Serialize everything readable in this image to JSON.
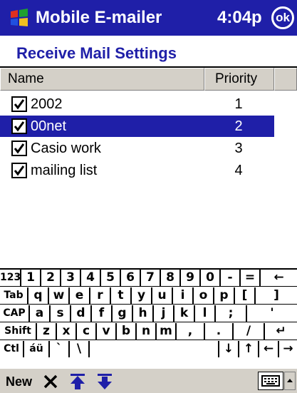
{
  "titlebar": {
    "app_title": "Mobile E-mailer",
    "clock": "4:04p",
    "ok_label": "ok",
    "bg_color": "#1f1fa8"
  },
  "page_title": "Receive Mail Settings",
  "list": {
    "columns": [
      "Name",
      "Priority"
    ],
    "rows": [
      {
        "name": "2002",
        "priority": "1",
        "checked": true,
        "selected": false
      },
      {
        "name": "00net",
        "priority": "2",
        "checked": true,
        "selected": true
      },
      {
        "name": "Casio work",
        "priority": "3",
        "checked": true,
        "selected": false
      },
      {
        "name": "mailing list",
        "priority": "4",
        "checked": true,
        "selected": false
      }
    ]
  },
  "keyboard": {
    "rows": [
      [
        "123",
        "1",
        "2",
        "3",
        "4",
        "5",
        "6",
        "7",
        "8",
        "9",
        "0",
        "-",
        "=",
        "←"
      ],
      [
        "Tab",
        "q",
        "w",
        "e",
        "r",
        "t",
        "y",
        "u",
        "i",
        "o",
        "p",
        "[",
        "]"
      ],
      [
        "CAP",
        "a",
        "s",
        "d",
        "f",
        "g",
        "h",
        "j",
        "k",
        "l",
        ";",
        "'"
      ],
      [
        "Shift",
        "z",
        "x",
        "c",
        "v",
        "b",
        "n",
        "m",
        ",",
        ".",
        "/",
        "↵"
      ],
      [
        "Ctl",
        "áü",
        "`",
        "\\",
        "",
        "↓",
        "↑",
        "←",
        "→"
      ]
    ]
  },
  "command_bar": {
    "new_label": "New",
    "icons": [
      "delete-x-icon",
      "move-up-icon",
      "move-down-icon",
      "keyboard-icon",
      "sip-arrow-icon"
    ]
  }
}
